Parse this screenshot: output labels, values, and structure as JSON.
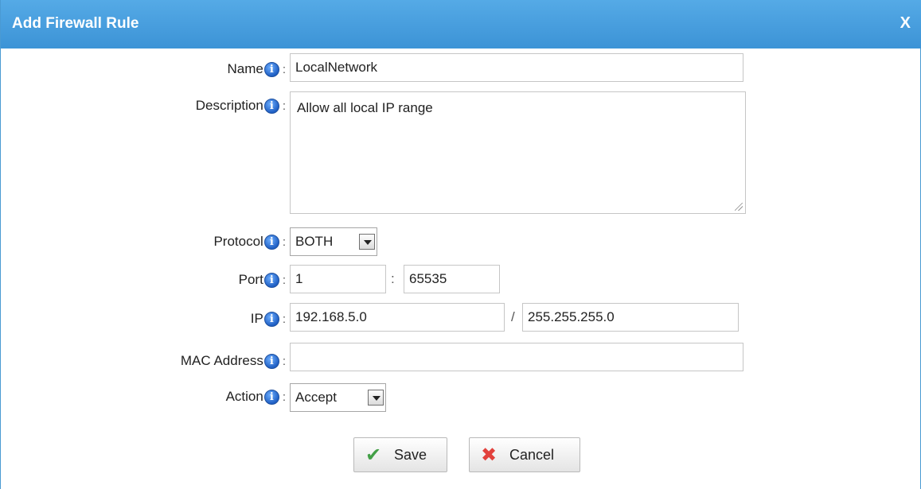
{
  "dialog": {
    "title": "Add Firewall Rule",
    "close_label": "X"
  },
  "form": {
    "name": {
      "label": "Name",
      "value": "LocalNetwork"
    },
    "description": {
      "label": "Description",
      "value": "Allow all local IP range"
    },
    "protocol": {
      "label": "Protocol",
      "value": "BOTH"
    },
    "port": {
      "label": "Port",
      "from": "1",
      "separator": ":",
      "to": "65535"
    },
    "ip": {
      "label": "IP",
      "address": "192.168.5.0",
      "separator": "/",
      "mask": "255.255.255.0"
    },
    "mac": {
      "label": "MAC Address",
      "value": ""
    },
    "action": {
      "label": "Action",
      "value": "Accept"
    }
  },
  "buttons": {
    "save": "Save",
    "cancel": "Cancel"
  },
  "icons": {
    "info": "i",
    "colon": ":"
  },
  "colors": {
    "titlebar": "#3c93d6",
    "save_icon": "#43a047",
    "cancel_icon": "#e2413c"
  }
}
